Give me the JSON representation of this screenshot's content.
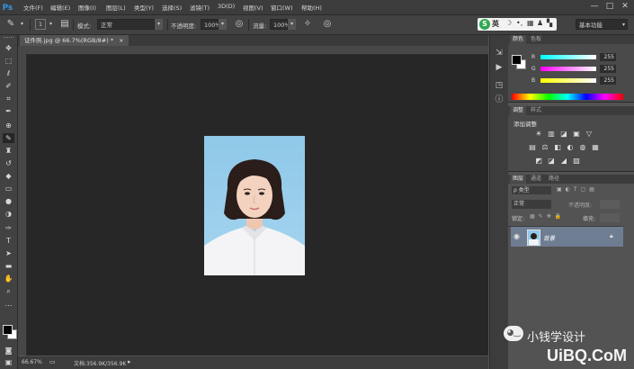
{
  "app": {
    "logo": "Ps"
  },
  "menubar": {
    "items": [
      "文件(F)",
      "编辑(E)",
      "图像(I)",
      "图层(L)",
      "类型(Y)",
      "选择(S)",
      "滤镜(T)",
      "3D(D)",
      "视图(V)",
      "窗口(W)",
      "帮助(H)"
    ],
    "window_buttons": [
      "—",
      "□",
      "✕"
    ]
  },
  "options_bar": {
    "brush_size": "1",
    "mode_label": "模式:",
    "mode_value": "正常",
    "opacity_label": "不透明度:",
    "opacity_value": "100%",
    "flow_label": "流量:",
    "flow_value": "100%",
    "ime_text": "英",
    "workspace": "基本功能"
  },
  "document": {
    "tab_title": "证件照.jpg @ 66.7%(RGB/8#) *",
    "zoom": "66.67%",
    "doc_info": "文档:356.9K/356.9K"
  },
  "color_panel": {
    "tabs": [
      "颜色",
      "色板"
    ],
    "channels": [
      {
        "label": "R",
        "value": "255",
        "gradient": "linear-gradient(to right,#00ffff,#ffffff)"
      },
      {
        "label": "G",
        "value": "255",
        "gradient": "linear-gradient(to right,#ff00ff,#ffffff)"
      },
      {
        "label": "B",
        "value": "255",
        "gradient": "linear-gradient(to right,#ffff00,#ffffff)"
      }
    ]
  },
  "adjustments_panel": {
    "tabs": [
      "调整",
      "样式"
    ],
    "title": "添加调整",
    "icons_row1": [
      "☀",
      "▥",
      "◪",
      "▣",
      "▽"
    ],
    "icons_row2": [
      "▤",
      "⚖",
      "◧",
      "◐",
      "◍",
      "▦"
    ],
    "icons_row3": [
      "◩",
      "◪",
      "◢",
      "▨"
    ]
  },
  "layers_panel": {
    "tabs": [
      "图层",
      "通道",
      "路径"
    ],
    "filter_label": "ρ 类型",
    "blend_mode": "正常",
    "opacity_label": "不透明度:",
    "lock_label": "锁定:",
    "fill_label": "填充:",
    "layer_name": "背景"
  },
  "watermark": {
    "text": "小钱学设计",
    "site": "UiBQ.CoM"
  },
  "colors": {
    "accent": "#31a8ff",
    "canvas": "#272727",
    "layer_selected": "#6f7d92"
  }
}
